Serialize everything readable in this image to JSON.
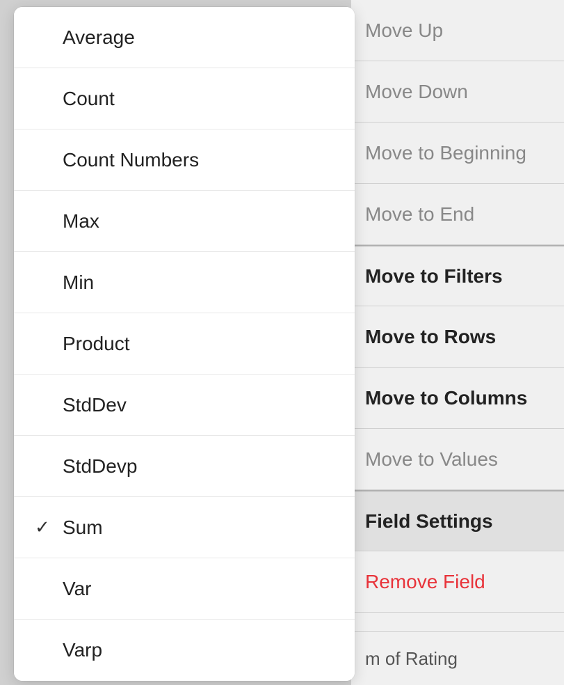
{
  "rightMenu": {
    "items": [
      {
        "id": "move-up",
        "label": "Move Up",
        "style": "gray",
        "bold": false,
        "separator": false
      },
      {
        "id": "move-down",
        "label": "Move Down",
        "style": "gray",
        "bold": false,
        "separator": false
      },
      {
        "id": "move-to-beginning",
        "label": "Move to Beginning",
        "style": "gray",
        "bold": false,
        "separator": false
      },
      {
        "id": "move-to-end",
        "label": "Move to End",
        "style": "gray",
        "bold": false,
        "separator": true
      },
      {
        "id": "move-to-filters",
        "label": "Move to Filters",
        "style": "bold",
        "bold": true,
        "separator": false
      },
      {
        "id": "move-to-rows",
        "label": "Move to Rows",
        "style": "bold",
        "bold": true,
        "separator": false
      },
      {
        "id": "move-to-columns",
        "label": "Move to Columns",
        "style": "bold",
        "bold": true,
        "separator": false
      },
      {
        "id": "move-to-values",
        "label": "Move to Values",
        "style": "gray",
        "bold": false,
        "separator": false
      },
      {
        "id": "field-settings",
        "label": "Field Settings",
        "style": "bold",
        "bold": true,
        "separator": true,
        "active": true
      },
      {
        "id": "remove-field",
        "label": "Remove Field",
        "style": "red",
        "bold": false,
        "separator": false
      }
    ]
  },
  "leftMenu": {
    "items": [
      {
        "id": "average",
        "label": "Average",
        "checked": false
      },
      {
        "id": "count",
        "label": "Count",
        "checked": false
      },
      {
        "id": "count-numbers",
        "label": "Count Numbers",
        "checked": false
      },
      {
        "id": "max",
        "label": "Max",
        "checked": false
      },
      {
        "id": "min",
        "label": "Min",
        "checked": false
      },
      {
        "id": "product",
        "label": "Product",
        "checked": false
      },
      {
        "id": "stddev",
        "label": "StdDev",
        "checked": false
      },
      {
        "id": "stddevp",
        "label": "StdDevp",
        "checked": false
      },
      {
        "id": "sum",
        "label": "Sum",
        "checked": true
      },
      {
        "id": "var",
        "label": "Var",
        "checked": false
      },
      {
        "id": "varp",
        "label": "Varp",
        "checked": false
      }
    ]
  },
  "bottomLabel": {
    "text": "m of Rating"
  },
  "icons": {
    "checkmark": "✓"
  }
}
